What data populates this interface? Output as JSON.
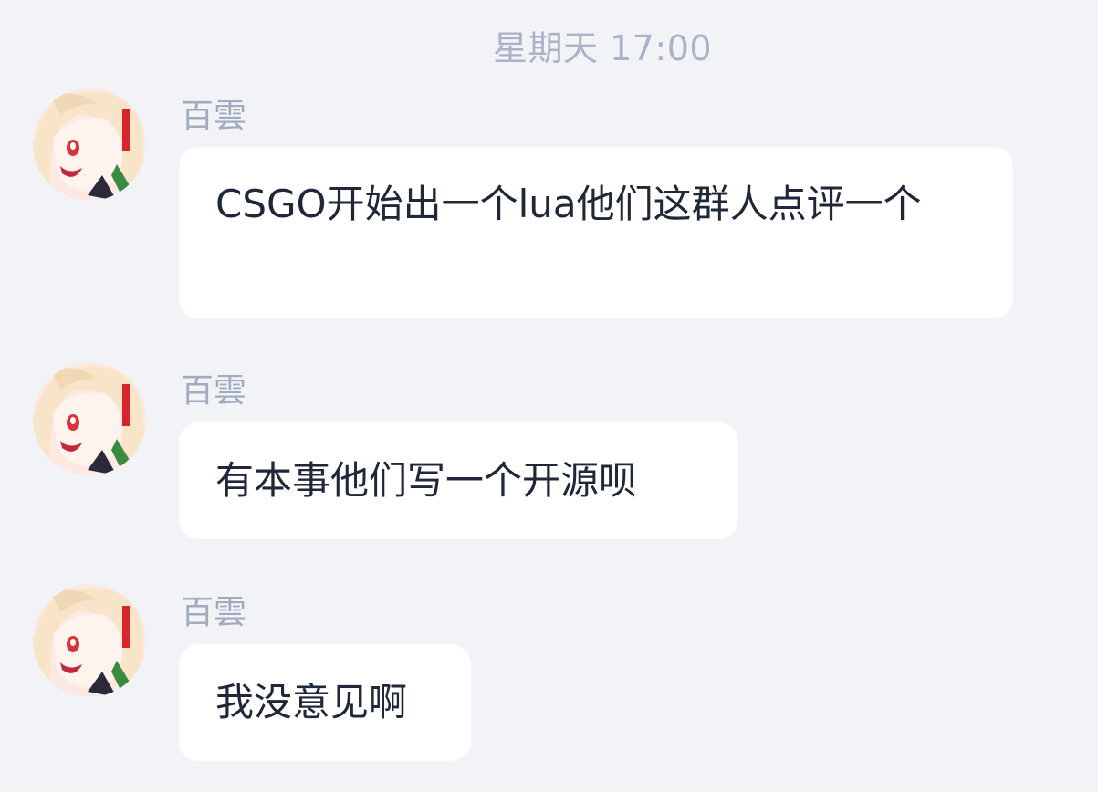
{
  "timestamp": "星期天 17:00",
  "messages": [
    {
      "sender": "百雲",
      "text": "CSGO开始出一个lua他们这群人点评一个"
    },
    {
      "sender": "百雲",
      "text": "有本事他们写一个开源呗"
    },
    {
      "sender": "百雲",
      "text": "我没意见啊"
    }
  ],
  "avatar_icon": "anime-girl-avatar-icon",
  "colors": {
    "background": "#f2f3f7",
    "bubble": "#ffffff",
    "timestamp": "#a9b2c7",
    "sender": "#a2abbd",
    "text": "#1f2738"
  }
}
